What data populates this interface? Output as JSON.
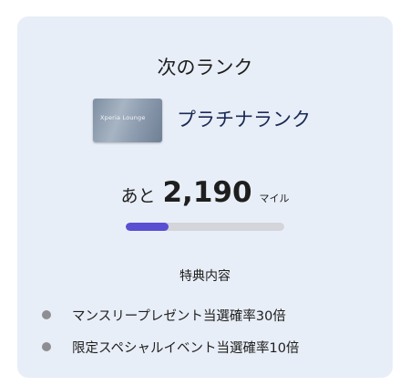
{
  "card": {
    "title": "次のランク",
    "rank": {
      "card_label": "Xperia Lounge",
      "name": "プラチナランク"
    },
    "remaining": {
      "prefix": "あと",
      "miles": "2,190",
      "unit": "マイル",
      "progress_fraction": 0.27
    },
    "benefits": {
      "heading": "特典内容",
      "items": [
        "マンスリープレゼント当選確率30倍",
        "限定スペシャルイベント当選確率10倍"
      ]
    }
  },
  "colors": {
    "card_background": "#e8eef7",
    "progress_fill": "#5a4fd2",
    "progress_track": "#d4d4db",
    "rank_name_text": "#1a2a56",
    "bullet": "#8e8e92"
  }
}
